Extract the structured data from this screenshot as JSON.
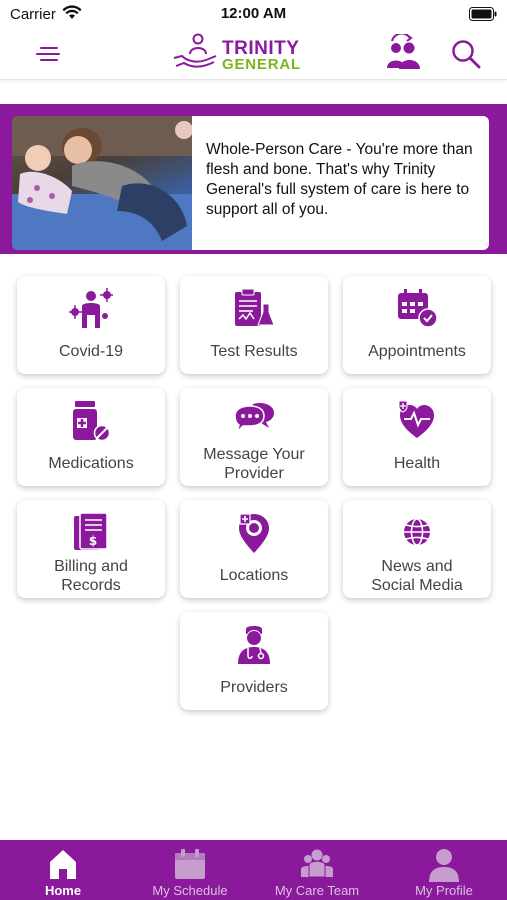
{
  "status_bar": {
    "carrier": "Carrier",
    "time": "12:00 AM"
  },
  "header": {
    "logo_line1": "TRINITY",
    "logo_line2": "GENERAL",
    "colors": {
      "brand_purple": "#8a1a9b",
      "brand_green": "#7ab51d"
    }
  },
  "banner": {
    "text": "Whole-Person Care - You're more than flesh and bone. That's why Trinity General's full system of care is here to support all of you."
  },
  "tiles": [
    {
      "label": "Covid-19",
      "icon": "virus-person-icon"
    },
    {
      "label": "Test Results",
      "icon": "clipboard-flask-icon"
    },
    {
      "label": "Appointments",
      "icon": "calendar-check-icon"
    },
    {
      "label": "Medications",
      "icon": "pill-bottle-icon"
    },
    {
      "label": "Message Your Provider",
      "icon": "chat-bubbles-icon"
    },
    {
      "label": "Health",
      "icon": "heart-pulse-icon"
    },
    {
      "label": "Billing and Records",
      "icon": "bill-document-icon"
    },
    {
      "label": "Locations",
      "icon": "location-pin-icon"
    },
    {
      "label": "News and Social Media",
      "icon": "globe-icon"
    },
    {
      "label": "Providers",
      "icon": "doctor-icon"
    }
  ],
  "tabbar": {
    "items": [
      {
        "label": "Home",
        "icon": "home-icon",
        "active": true
      },
      {
        "label": "My Schedule",
        "icon": "calendar-icon",
        "active": false
      },
      {
        "label": "My Care Team",
        "icon": "group-icon",
        "active": false
      },
      {
        "label": "My Profile",
        "icon": "person-icon",
        "active": false
      }
    ]
  }
}
